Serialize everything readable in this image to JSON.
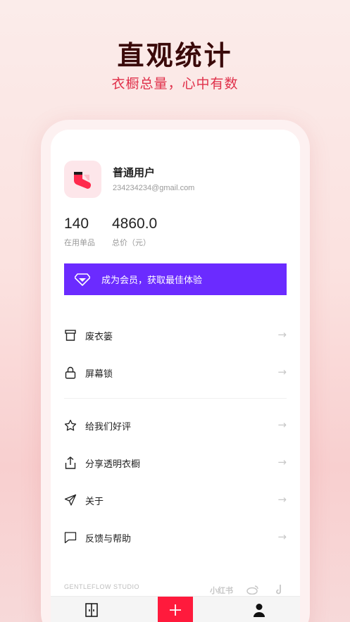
{
  "promo": {
    "title": "直观统计",
    "subtitle": "衣橱总量，心中有数"
  },
  "profile": {
    "name": "普通用户",
    "email": "234234234@gmail.com",
    "avatar_icon": "sock-icon"
  },
  "stats": [
    {
      "value": "140",
      "label": "在用单品"
    },
    {
      "value": "4860.0",
      "label": "总价（元）"
    }
  ],
  "vip_banner": {
    "text": "成为会员，获取最佳体验",
    "icon": "diamond-icon",
    "color": "#6b2bff"
  },
  "menu": {
    "group1": [
      {
        "label": "废衣篓",
        "icon": "archive-box-icon"
      },
      {
        "label": "屏幕锁",
        "icon": "lock-icon"
      }
    ],
    "group2": [
      {
        "label": "给我们好评",
        "icon": "star-icon"
      },
      {
        "label": "分享透明衣橱",
        "icon": "share-icon"
      },
      {
        "label": "关于",
        "icon": "send-icon"
      },
      {
        "label": "反馈与帮助",
        "icon": "chat-bubble-icon"
      }
    ],
    "arrow": "→"
  },
  "footer": {
    "studio": "GENTLEFLOW STUDIO",
    "social": [
      "小红书"
    ]
  },
  "tabbar": {
    "tabs": [
      "wardrobe-icon",
      "add-icon",
      "profile-icon"
    ],
    "accent": "#ff1a3c"
  }
}
